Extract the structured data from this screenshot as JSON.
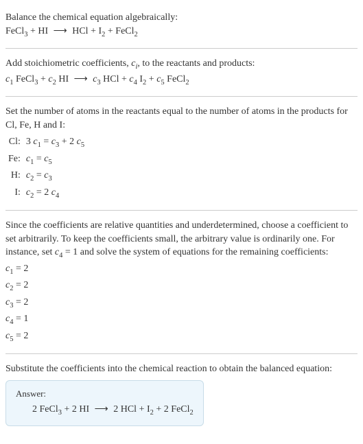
{
  "intro": {
    "line1": "Balance the chemical equation algebraically:",
    "eq_lhs1": "FeCl",
    "eq_lhs1_sub": "3",
    "eq_plus1": " + HI ",
    "arrow": "⟶",
    "eq_rhs1": " HCl + I",
    "eq_rhs1_sub": "2",
    "eq_rhs2": " + FeCl",
    "eq_rhs2_sub": "2"
  },
  "stoich": {
    "text_a": "Add stoichiometric coefficients, ",
    "ci": "c",
    "ci_sub": "i",
    "text_b": ", to the reactants and products:",
    "c1": "c",
    "c1s": "1",
    "sp1": " FeCl",
    "sp1s": "3",
    "plus": " + ",
    "c2": "c",
    "c2s": "2",
    "sp2": " HI ",
    "arrow": "⟶",
    "c3": " c",
    "c3s": "3",
    "sp3": " HCl + ",
    "c4": "c",
    "c4s": "4",
    "sp4": " I",
    "sp4s": "2",
    "plus2": " + ",
    "c5": "c",
    "c5s": "5",
    "sp5": " FeCl",
    "sp5s": "2"
  },
  "atoms": {
    "text": "Set the number of atoms in the reactants equal to the number of atoms in the products for Cl, Fe, H and I:",
    "rows": [
      {
        "el": "Cl:",
        "lhs_a": "3 ",
        "lhs_c": "c",
        "lhs_s": "1",
        "eq": " = ",
        "r_c1": "c",
        "r_s1": "3",
        "r_mid": " + 2 ",
        "r_c2": "c",
        "r_s2": "5"
      },
      {
        "el": "Fe:",
        "lhs_a": "",
        "lhs_c": "c",
        "lhs_s": "1",
        "eq": " = ",
        "r_c1": "c",
        "r_s1": "5",
        "r_mid": "",
        "r_c2": "",
        "r_s2": ""
      },
      {
        "el": "H:",
        "lhs_a": "",
        "lhs_c": "c",
        "lhs_s": "2",
        "eq": " = ",
        "r_c1": "c",
        "r_s1": "3",
        "r_mid": "",
        "r_c2": "",
        "r_s2": ""
      },
      {
        "el": "I:",
        "lhs_a": "",
        "lhs_c": "c",
        "lhs_s": "2",
        "eq": " = 2 ",
        "r_c1": "c",
        "r_s1": "4",
        "r_mid": "",
        "r_c2": "",
        "r_s2": ""
      }
    ]
  },
  "choose": {
    "text_a": "Since the coefficients are relative quantities and underdetermined, choose a coefficient to set arbitrarily. To keep the coefficients small, the arbitrary value is ordinarily one. For instance, set ",
    "cv": "c",
    "cvs": "4",
    "text_b": " = 1 and solve the system of equations for the remaining coefficients:",
    "coefs": [
      {
        "c": "c",
        "s": "1",
        "v": " = 2"
      },
      {
        "c": "c",
        "s": "2",
        "v": " = 2"
      },
      {
        "c": "c",
        "s": "3",
        "v": " = 2"
      },
      {
        "c": "c",
        "s": "4",
        "v": " = 1"
      },
      {
        "c": "c",
        "s": "5",
        "v": " = 2"
      }
    ]
  },
  "final": {
    "text": "Substitute the coefficients into the chemical reaction to obtain the balanced equation:",
    "answer_label": "Answer:",
    "eq_a": "2 FeCl",
    "eq_as": "3",
    "eq_b": " + 2 HI ",
    "arrow": "⟶",
    "eq_c": " 2 HCl + I",
    "eq_cs": "2",
    "eq_d": " + 2 FeCl",
    "eq_ds": "2"
  }
}
